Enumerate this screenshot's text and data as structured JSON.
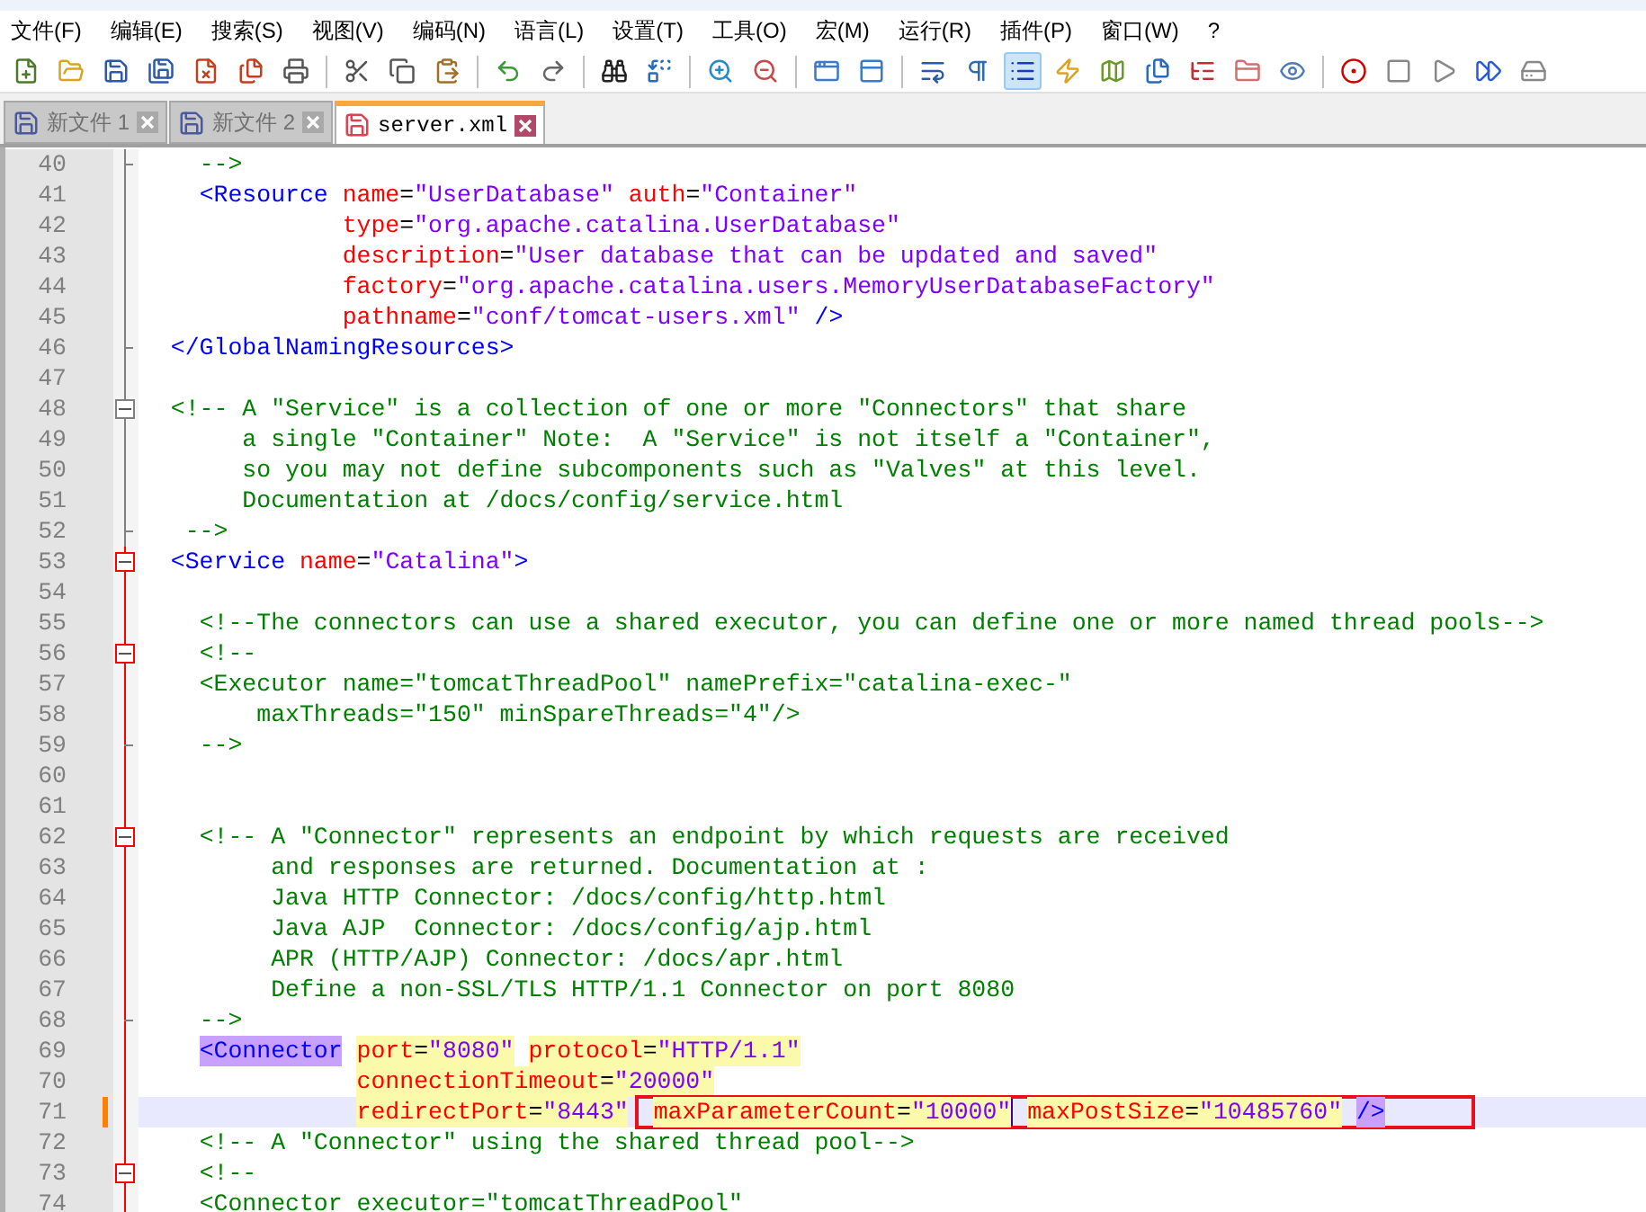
{
  "menu": [
    "文件(F)",
    "编辑(E)",
    "搜索(S)",
    "视图(V)",
    "编码(N)",
    "语言(L)",
    "设置(T)",
    "工具(O)",
    "宏(M)",
    "运行(R)",
    "插件(P)",
    "窗口(W)",
    "?"
  ],
  "toolbar": [
    {
      "pressed": false
    },
    {
      "pressed": false
    },
    {
      "pressed": false
    },
    {
      "pressed": false
    },
    {
      "pressed": false
    },
    {
      "pressed": false
    },
    {
      "pressed": false
    },
    {
      "pressed": false
    },
    {
      "pressed": false
    },
    {
      "pressed": false
    },
    {
      "pressed": false
    },
    {
      "pressed": false
    },
    {
      "pressed": false
    },
    {
      "pressed": false
    },
    {
      "pressed": false
    },
    {
      "pressed": false
    },
    {
      "pressed": false
    },
    {
      "pressed": false
    },
    {
      "pressed": false
    },
    {
      "pressed": false
    },
    {
      "pressed": true
    },
    {
      "pressed": false
    },
    {
      "pressed": false
    },
    {
      "pressed": false
    },
    {
      "pressed": false
    },
    {
      "pressed": false
    },
    {
      "pressed": false
    },
    {
      "pressed": false
    },
    {
      "pressed": false
    },
    {
      "pressed": false
    },
    {
      "pressed": false
    },
    {
      "pressed": false
    }
  ],
  "tabs": [
    {
      "label": "新文件 1",
      "selected": false,
      "modified": false
    },
    {
      "label": "新文件 2",
      "selected": false,
      "modified": false
    },
    {
      "label": "server.xml",
      "selected": true,
      "modified": true
    }
  ],
  "lines": [
    {
      "number": "40",
      "fold_start": false,
      "fold_end": true,
      "fold_active": false,
      "current": false,
      "changed": false,
      "tokens": [
        {
          "kind": "comment",
          "text": "    -->"
        }
      ]
    },
    {
      "number": "41",
      "fold_start": false,
      "fold_end": false,
      "fold_active": false,
      "current": false,
      "changed": false,
      "tokens": [
        {
          "kind": "tag",
          "text": "    <Resource"
        },
        {
          "kind": "attr",
          "text": " name"
        },
        {
          "kind": "plain",
          "text": "="
        },
        {
          "kind": "value",
          "text": "\"UserDatabase\""
        },
        {
          "kind": "attr",
          "text": " auth"
        },
        {
          "kind": "plain",
          "text": "="
        },
        {
          "kind": "value",
          "text": "\"Container\""
        }
      ]
    },
    {
      "number": "42",
      "fold_start": false,
      "fold_end": false,
      "fold_active": false,
      "current": false,
      "changed": false,
      "tokens": [
        {
          "kind": "attr",
          "text": "              type"
        },
        {
          "kind": "plain",
          "text": "="
        },
        {
          "kind": "value",
          "text": "\"org.apache.catalina.UserDatabase\""
        }
      ]
    },
    {
      "number": "43",
      "fold_start": false,
      "fold_end": false,
      "fold_active": false,
      "current": false,
      "changed": false,
      "tokens": [
        {
          "kind": "attr",
          "text": "              description"
        },
        {
          "kind": "plain",
          "text": "="
        },
        {
          "kind": "value",
          "text": "\"User database that can be updated and saved\""
        }
      ]
    },
    {
      "number": "44",
      "fold_start": false,
      "fold_end": false,
      "fold_active": false,
      "current": false,
      "changed": false,
      "tokens": [
        {
          "kind": "attr",
          "text": "              factory"
        },
        {
          "kind": "plain",
          "text": "="
        },
        {
          "kind": "value",
          "text": "\"org.apache.catalina.users.MemoryUserDatabaseFactory\""
        }
      ]
    },
    {
      "number": "45",
      "fold_start": false,
      "fold_end": false,
      "fold_active": false,
      "current": false,
      "changed": false,
      "tokens": [
        {
          "kind": "attr",
          "text": "              pathname"
        },
        {
          "kind": "plain",
          "text": "="
        },
        {
          "kind": "value",
          "text": "\"conf/tomcat-users.xml\""
        },
        {
          "kind": "tag",
          "text": " />"
        }
      ]
    },
    {
      "number": "46",
      "fold_start": false,
      "fold_end": true,
      "fold_active": false,
      "current": false,
      "changed": false,
      "tokens": [
        {
          "kind": "tag",
          "text": "  </GlobalNamingResources>"
        }
      ]
    },
    {
      "number": "47",
      "fold_start": false,
      "fold_end": false,
      "fold_active": false,
      "current": false,
      "changed": false
    },
    {
      "number": "48",
      "fold_start": true,
      "fold_end": false,
      "fold_active": false,
      "current": false,
      "changed": false,
      "tokens": [
        {
          "kind": "comment",
          "text": "  <!-- A \"Service\" is a collection of one or more \"Connectors\" that share"
        }
      ]
    },
    {
      "number": "49",
      "fold_start": false,
      "fold_end": false,
      "fold_active": false,
      "current": false,
      "changed": false,
      "tokens": [
        {
          "kind": "comment",
          "text": "       a single \"Container\" Note:  A \"Service\" is not itself a \"Container\","
        }
      ]
    },
    {
      "number": "50",
      "fold_start": false,
      "fold_end": false,
      "fold_active": false,
      "current": false,
      "changed": false,
      "tokens": [
        {
          "kind": "comment",
          "text": "       so you may not define subcomponents such as \"Valves\" at this level."
        }
      ]
    },
    {
      "number": "51",
      "fold_start": false,
      "fold_end": false,
      "fold_active": false,
      "current": false,
      "changed": false,
      "tokens": [
        {
          "kind": "comment",
          "text": "       Documentation at /docs/config/service.html"
        }
      ]
    },
    {
      "number": "52",
      "fold_start": false,
      "fold_end": true,
      "fold_active": false,
      "current": false,
      "changed": false,
      "tokens": [
        {
          "kind": "comment",
          "text": "   -->"
        }
      ]
    },
    {
      "number": "53",
      "fold_start": true,
      "fold_end": false,
      "fold_active": true,
      "current": false,
      "changed": false,
      "tokens": [
        {
          "kind": "tag",
          "text": "  <Service"
        },
        {
          "kind": "attr",
          "text": " name"
        },
        {
          "kind": "plain",
          "text": "="
        },
        {
          "kind": "value",
          "text": "\"Catalina\""
        },
        {
          "kind": "tag",
          "text": ">"
        }
      ]
    },
    {
      "number": "54",
      "fold_start": false,
      "fold_end": false,
      "fold_active": true,
      "current": false,
      "changed": false
    },
    {
      "number": "55",
      "fold_start": false,
      "fold_end": false,
      "fold_active": true,
      "current": false,
      "changed": false,
      "tokens": [
        {
          "kind": "comment",
          "text": "    <!--The connectors can use a shared executor, you can define one or more named thread pools-->"
        }
      ]
    },
    {
      "number": "56",
      "fold_start": true,
      "fold_end": false,
      "fold_active": true,
      "current": false,
      "changed": false,
      "tokens": [
        {
          "kind": "comment",
          "text": "    <!--"
        }
      ]
    },
    {
      "number": "57",
      "fold_start": false,
      "fold_end": false,
      "fold_active": true,
      "current": false,
      "changed": false,
      "tokens": [
        {
          "kind": "comment",
          "text": "    <Executor name=\"tomcatThreadPool\" namePrefix=\"catalina-exec-\""
        }
      ]
    },
    {
      "number": "58",
      "fold_start": false,
      "fold_end": false,
      "fold_active": true,
      "current": false,
      "changed": false,
      "tokens": [
        {
          "kind": "comment",
          "text": "        maxThreads=\"150\" minSpareThreads=\"4\"/>"
        }
      ]
    },
    {
      "number": "59",
      "fold_start": false,
      "fold_end": true,
      "fold_active": true,
      "current": false,
      "changed": false,
      "tokens": [
        {
          "kind": "comment",
          "text": "    -->"
        }
      ]
    },
    {
      "number": "60",
      "fold_start": false,
      "fold_end": false,
      "fold_active": true,
      "current": false,
      "changed": false
    },
    {
      "number": "61",
      "fold_start": false,
      "fold_end": false,
      "fold_active": true,
      "current": false,
      "changed": false
    },
    {
      "number": "62",
      "fold_start": true,
      "fold_end": false,
      "fold_active": true,
      "current": false,
      "changed": false,
      "tokens": [
        {
          "kind": "comment",
          "text": "    <!-- A \"Connector\" represents an endpoint by which requests are received"
        }
      ]
    },
    {
      "number": "63",
      "fold_start": false,
      "fold_end": false,
      "fold_active": true,
      "current": false,
      "changed": false,
      "tokens": [
        {
          "kind": "comment",
          "text": "         and responses are returned. Documentation at :"
        }
      ]
    },
    {
      "number": "64",
      "fold_start": false,
      "fold_end": false,
      "fold_active": true,
      "current": false,
      "changed": false,
      "tokens": [
        {
          "kind": "comment",
          "text": "         Java HTTP Connector: /docs/config/http.html"
        }
      ]
    },
    {
      "number": "65",
      "fold_start": false,
      "fold_end": false,
      "fold_active": true,
      "current": false,
      "changed": false,
      "tokens": [
        {
          "kind": "comment",
          "text": "         Java AJP  Connector: /docs/config/ajp.html"
        }
      ]
    },
    {
      "number": "66",
      "fold_start": false,
      "fold_end": false,
      "fold_active": true,
      "current": false,
      "changed": false,
      "tokens": [
        {
          "kind": "comment",
          "text": "         APR (HTTP/AJP) Connector: /docs/apr.html"
        }
      ]
    },
    {
      "number": "67",
      "fold_start": false,
      "fold_end": false,
      "fold_active": true,
      "current": false,
      "changed": false,
      "tokens": [
        {
          "kind": "comment",
          "text": "         Define a non-SSL/TLS HTTP/1.1 Connector on port 8080"
        }
      ]
    },
    {
      "number": "68",
      "fold_start": false,
      "fold_end": true,
      "fold_active": true,
      "current": false,
      "changed": false,
      "tokens": [
        {
          "kind": "comment",
          "text": "    -->"
        }
      ]
    },
    {
      "number": "69",
      "fold_start": false,
      "fold_end": false,
      "fold_active": true,
      "current": false,
      "changed": false,
      "tokens": [
        {
          "kind": "tag",
          "text": "    <Connector",
          "highlighted": true
        },
        {
          "kind": "attr",
          "text": " port",
          "highlighted": true
        },
        {
          "kind": "plain",
          "text": "=",
          "highlighted": true
        },
        {
          "kind": "value",
          "text": "\"8080\"",
          "highlighted": true
        },
        {
          "kind": "attr",
          "text": " protocol",
          "highlighted": true
        },
        {
          "kind": "plain",
          "text": "=",
          "highlighted": true
        },
        {
          "kind": "value",
          "text": "\"HTTP/1.1\"",
          "highlighted": true
        }
      ]
    },
    {
      "number": "70",
      "fold_start": false,
      "fold_end": false,
      "fold_active": true,
      "current": false,
      "changed": false,
      "tokens": [
        {
          "kind": "attr",
          "text": "               connectionTimeout",
          "highlighted": true
        },
        {
          "kind": "plain",
          "text": "=",
          "highlighted": true
        },
        {
          "kind": "value",
          "text": "\"20000\"",
          "highlighted": true
        }
      ]
    },
    {
      "number": "71",
      "fold_start": false,
      "fold_end": false,
      "fold_active": true,
      "current": true,
      "changed": true,
      "tokens": [
        {
          "kind": "attr",
          "text": "               redirectPort",
          "highlighted": true
        },
        {
          "kind": "plain",
          "text": "=",
          "highlighted": true
        },
        {
          "kind": "value",
          "text": "\"8443\"",
          "highlighted": true
        }
      ],
      "boxed_tokens": [
        {
          "kind": "attr",
          "text": " maxParameterCount",
          "highlighted": true
        },
        {
          "kind": "plain",
          "text": "=",
          "highlighted": true
        },
        {
          "kind": "value",
          "text": "\"10000\"",
          "highlighted": true,
          "caret_after": true
        },
        {
          "kind": "attr",
          "text": " maxPostSize",
          "highlighted": true
        },
        {
          "kind": "plain",
          "text": "=",
          "highlighted": true
        },
        {
          "kind": "value",
          "text": "\"10485760\"",
          "highlighted": true
        },
        {
          "kind": "tag",
          "text": " />",
          "highlighted": true
        }
      ]
    },
    {
      "number": "72",
      "fold_start": false,
      "fold_end": false,
      "fold_active": true,
      "current": false,
      "changed": false,
      "tokens": [
        {
          "kind": "comment",
          "text": "    <!-- A \"Connector\" using the shared thread pool-->"
        }
      ]
    },
    {
      "number": "73",
      "fold_start": true,
      "fold_end": false,
      "fold_active": true,
      "current": false,
      "changed": false,
      "tokens": [
        {
          "kind": "comment",
          "text": "    <!--"
        }
      ]
    },
    {
      "number": "74",
      "fold_start": false,
      "fold_end": false,
      "fold_active": true,
      "current": false,
      "changed": false,
      "tokens": [
        {
          "kind": "comment",
          "text": "    <Connector executor=\"tomcatThreadPool\""
        }
      ]
    }
  ]
}
